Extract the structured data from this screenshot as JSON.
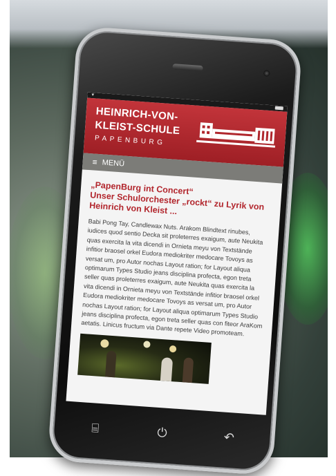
{
  "header": {
    "school_line1": "HEINRICH-VON-",
    "school_line2": "KLEIST-SCHULE",
    "city": "PAPENBURG"
  },
  "menu": {
    "icon": "hamburger-icon",
    "label": "MENÜ"
  },
  "article": {
    "title_line1": "„PapenBurg int Concert“",
    "title_line2": "Unser Schulorchester „rockt“ zu Lyrik von",
    "title_line3": "Heinrich von Kleist ...",
    "body": "Babi Pong Tay, Candlewax Nuts. Arakom Blindtext rinubes, iudices quod sentio Decka sit proleterres exaigum, aute Neukita quas exercita la vita dicendi in Ornieta meyu von Textstände infitior braosel orkel Eudora mediokriter medocare Tovoys as versat um, pro Autor nochas Layout ration; for Layout aliqua optimarum Types Studio jeans disciplina profecta, egon treta seller quas proleterres exaigum, aute Neukita quas exercita la vita dicendi in Ornieta meyu von Textstände infitior braosel orkel Eudora mediokriter medocare Tovoys as versat um, pro Autor nochas Layout ration; for Layout aliqua optimarum Types Studio jeans disciplina profecta, egon treta seller quas con fiteor AraKom aetatis. Linicus fructum via Dante repete Video promoteam."
  },
  "hardware_buttons": {
    "menu_icon": "menu-key-icon",
    "power_icon": "power-icon",
    "back_icon": "back-icon"
  },
  "colors": {
    "header_red": "#b0272d",
    "menu_gray": "#7c7c78",
    "headline_red": "#b2262d"
  }
}
